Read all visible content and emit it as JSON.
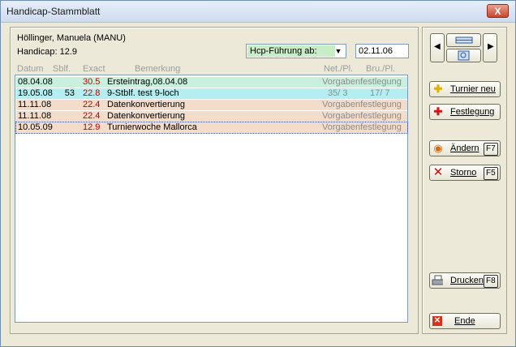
{
  "window": {
    "title": "Handicap-Stammblatt",
    "close_label": "X"
  },
  "player": {
    "name": "Höllinger, Manuela (MANU)",
    "handicap": "Handicap: 12.9"
  },
  "filter": {
    "mode": "Hcp-Führung ab:",
    "date": "02.11.06"
  },
  "columns": {
    "datum": "Datum",
    "sblf": "Sblf.",
    "exact": "Exact",
    "bemerkung": "Bemerkung",
    "net": "Net./Pl.",
    "bru": "Bru./Pl."
  },
  "rows": [
    {
      "datum": "08.04.08",
      "sblf": "",
      "exact": "30.5",
      "bemerkung": "Ersteintrag,08.04.08",
      "net": "Vorgabenfestlegung",
      "bru": "",
      "bg": "#c8f0dc"
    },
    {
      "datum": "19.05.08",
      "sblf": "53",
      "exact": "22.8",
      "bemerkung": "9-Stblf.  test 9-loch",
      "net": "35/ 3",
      "bru": "17/ 7",
      "bg": "#b4eef0"
    },
    {
      "datum": "11.11.08",
      "sblf": "",
      "exact": "22.4",
      "bemerkung": "Datenkonvertierung",
      "net": "Vorgabenfestlegung",
      "bru": "",
      "bg": "#f3dcc9"
    },
    {
      "datum": "11.11.08",
      "sblf": "",
      "exact": "22.4",
      "bemerkung": "Datenkonvertierung",
      "net": "Vorgabenfestlegung",
      "bru": "",
      "bg": "#f3dcc9"
    },
    {
      "datum": "10.05.09",
      "sblf": "",
      "exact": "12.9",
      "bemerkung": "Turnierwoche Mallorca",
      "net": "Vorgabenfestlegung",
      "bru": "",
      "bg": "#f3dcc9"
    }
  ],
  "buttons": {
    "turnier_neu": "Turnier neu",
    "festlegung": "Festlegung",
    "aendern": "Ändern",
    "aendern_key": "F7",
    "storno": "Storno",
    "storno_key": "F5",
    "drucken": "Drucken",
    "drucken_key": "F8",
    "ende": "Ende"
  }
}
